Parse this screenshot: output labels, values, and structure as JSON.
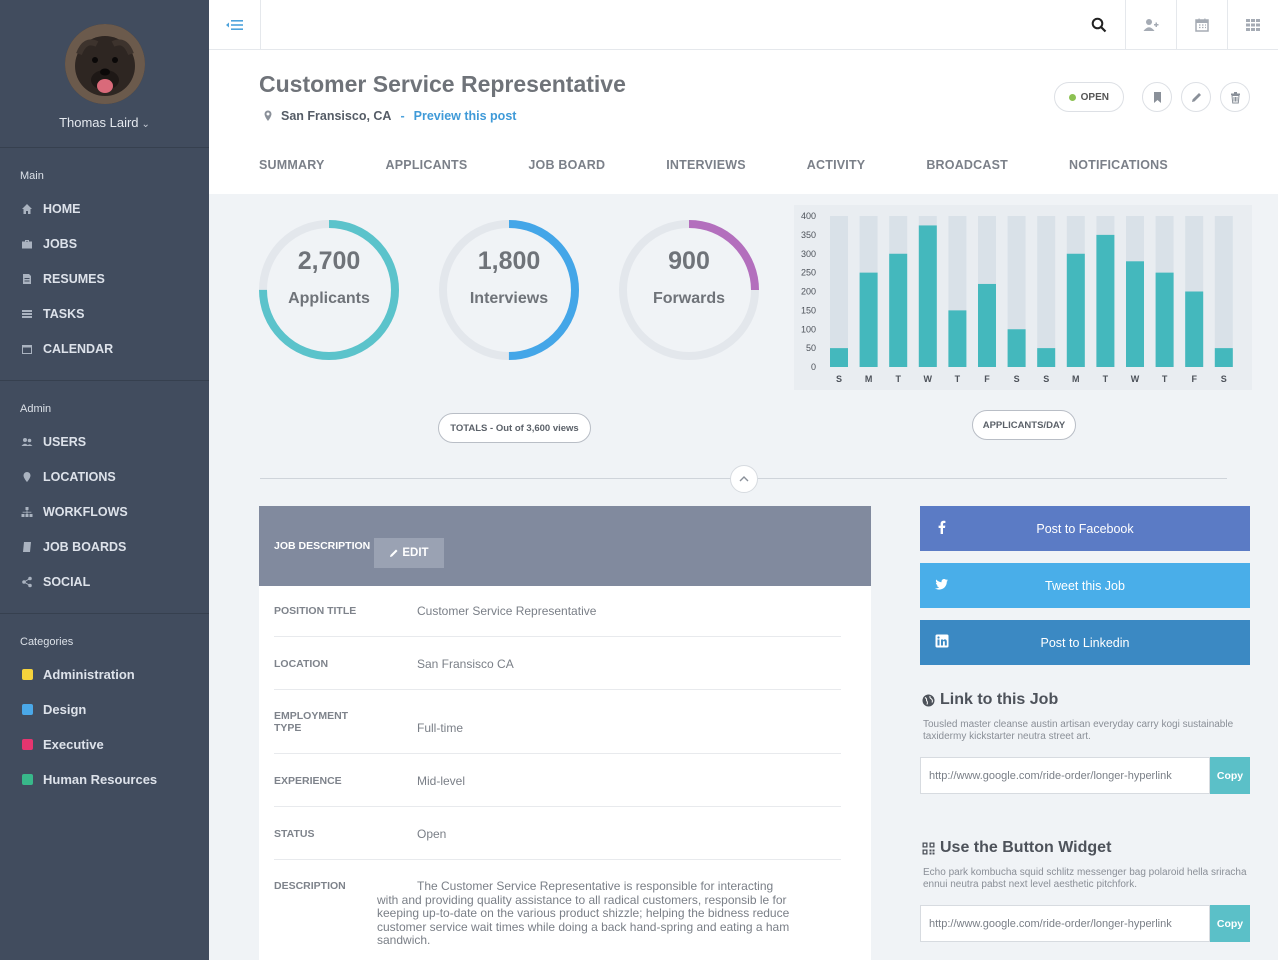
{
  "user": {
    "name": "Thomas Laird"
  },
  "sidebar": {
    "main_heading": "Main",
    "main_items": [
      "HOME",
      "JOBS",
      "RESUMES",
      "TASKS",
      "CALENDAR"
    ],
    "admin_heading": "Admin",
    "admin_items": [
      "USERS",
      "LOCATIONS",
      "WORKFLOWS",
      "JOB BOARDS",
      "SOCIAL"
    ],
    "categories_heading": "Categories",
    "categories": [
      {
        "label": "Administration",
        "color": "#f6d33c"
      },
      {
        "label": "Design",
        "color": "#4aa8e8"
      },
      {
        "label": "Executive",
        "color": "#e6356f"
      },
      {
        "label": "Human Resources",
        "color": "#38b88a"
      }
    ]
  },
  "job": {
    "title": "Customer Service Representative",
    "location": "San Fransisco, CA",
    "separator": "-",
    "preview_link": "Preview this post",
    "status": "OPEN"
  },
  "tabs": [
    "SUMMARY",
    "APPLICANTS",
    "JOB BOARD",
    "INTERVIEWS",
    "ACTIVITY",
    "BROADCAST",
    "NOTIFICATIONS"
  ],
  "stats": [
    {
      "value": "2,700",
      "label": "Applicants",
      "fraction": 0.75,
      "color": "#5bc3cb"
    },
    {
      "value": "1,800",
      "label": "Interviews",
      "fraction": 0.5,
      "color": "#44a6e8"
    },
    {
      "value": "900",
      "label": "Forwards",
      "fraction": 0.25,
      "color": "#b36fbd"
    }
  ],
  "totals_label": "TOTALS - Out of 3,600 views",
  "chart_data": {
    "type": "bar",
    "categories": [
      "S",
      "M",
      "T",
      "W",
      "T",
      "F",
      "S",
      "S",
      "M",
      "T",
      "W",
      "T",
      "F",
      "S"
    ],
    "values": [
      50,
      250,
      300,
      375,
      150,
      220,
      100,
      50,
      300,
      350,
      280,
      250,
      200,
      50
    ],
    "max_values": [
      400,
      400,
      400,
      400,
      400,
      400,
      400,
      400,
      400,
      400,
      400,
      400,
      400,
      400
    ],
    "yticks": [
      400,
      350,
      300,
      250,
      200,
      150,
      100,
      50,
      0
    ],
    "ylim": [
      0,
      400
    ],
    "bar_color": "#44b8bd",
    "track_color": "#d9e1e8",
    "label": "APPLICANTS/DAY"
  },
  "job_description": {
    "title": "JOB DESCRIPTION",
    "edit_label": "EDIT",
    "rows": [
      {
        "key": "POSITION TITLE",
        "value": "Customer Service Representative"
      },
      {
        "key": "LOCATION",
        "value": "San Fransisco CA"
      },
      {
        "key": "EMPLOYMENT TYPE",
        "value": "Full-time"
      },
      {
        "key": "EXPERIENCE",
        "value": "Mid-level"
      },
      {
        "key": "STATUS",
        "value": "Open"
      },
      {
        "key": "DESCRIPTION",
        "value": "The Customer Service Representative is responsible for interacting with and providing quality assistance to all radical customers, responsib le for keeping up-to-date on the various product shizzle; helping the bidness reduce customer service wait times while doing a back hand-spring and eating a ham sandwich."
      }
    ]
  },
  "social": {
    "facebook": {
      "label": "Post to Facebook",
      "color": "#5b7bc5"
    },
    "twitter": {
      "label": "Tweet this Job",
      "color": "#49aee9"
    },
    "linkedin": {
      "label": "Post to Linkedin",
      "color": "#3b89c3"
    }
  },
  "link_job": {
    "title": "Link to this Job",
    "text": "Tousled master cleanse austin artisan everyday carry kogi sustainable taxidermy kickstarter neutra street art.",
    "url": "http://www.google.com/ride-order/longer-hyperlink",
    "copy_label": "Copy"
  },
  "button_widget": {
    "title": "Use the Button Widget",
    "text": "Echo park kombucha squid schlitz messenger bag polaroid hella sriracha ennui neutra pabst next level aesthetic pitchfork.",
    "url": "http://www.google.com/ride-order/longer-hyperlink",
    "copy_label": "Copy"
  }
}
